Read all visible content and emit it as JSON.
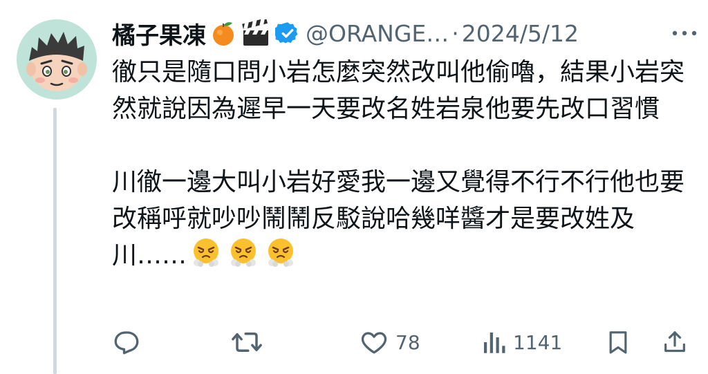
{
  "tweet": {
    "author": {
      "display_name": "橘子果凍",
      "name_emojis": [
        "orange-emoji",
        "clapperboard-emoji"
      ],
      "verified": true,
      "handle": "@ORANGE…",
      "avatar": "cartoon-boy-avatar"
    },
    "separator": "·",
    "date": "2024/5/12",
    "more_icon": "more-dots-icon",
    "text": {
      "para1": "徹只是隨口問小岩怎麼突然改叫他偷嚕，結果小岩突然就說因為遲早一天要改名姓岩泉他要先改口習慣",
      "para2": "川徹一邊大叫小岩好愛我一邊又覺得不行不行他也要改稱呼就吵吵鬧鬧反駁說哈幾咩醬才是要改姓及川……",
      "trailing_emojis": [
        "steam-from-nose-emoji",
        "steam-from-nose-emoji",
        "steam-from-nose-emoji"
      ]
    },
    "actions": {
      "reply": {
        "icon": "reply-icon",
        "count": ""
      },
      "retweet": {
        "icon": "retweet-icon",
        "count": ""
      },
      "like": {
        "icon": "heart-icon",
        "count": "78"
      },
      "views": {
        "icon": "views-icon",
        "count": "1141"
      },
      "bookmark": {
        "icon": "bookmark-icon"
      },
      "share": {
        "icon": "share-icon"
      }
    },
    "colors": {
      "text": "#0f1419",
      "muted": "#536471",
      "verified": "#1d9bf0",
      "avatar_bg": "#bfe3d8",
      "thread_line": "#cfd9de"
    }
  }
}
